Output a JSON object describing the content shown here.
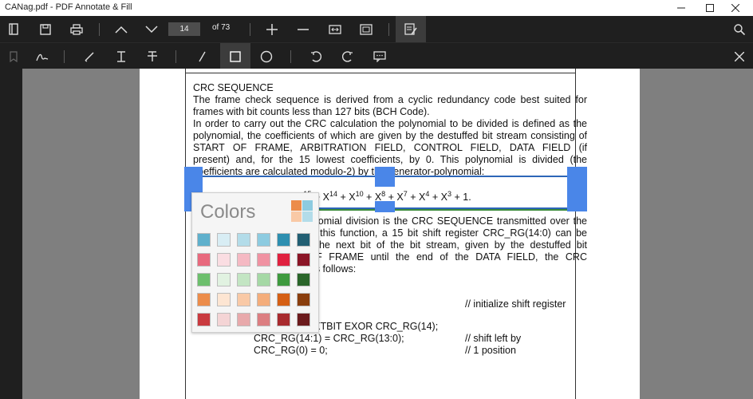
{
  "window": {
    "title": "CANag.pdf - PDF Annotate & Fill"
  },
  "toolbar": {
    "page_number": "14",
    "page_of": "of 73"
  },
  "document": {
    "heading": "CRC SEQUENCE",
    "lines": [
      "The frame check sequence is derived from a cyclic redundancy code best suited for",
      "frames with bit counts less than 127 bits (BCH Code).",
      "In order to carry out the CRC calculation the polynomial to be divided is defined as the",
      "polynomial, the coefficients of which are given by the destuffed bit stream consisting of",
      "START OF FRAME, ARBITRATION FIELD, CONTROL FIELD, DATA FIELD (if",
      "present) and, for the 15 lowest coefficients, by 0. This polynomial is divided (the",
      "coefficients are calculated modulo-2) by the generator-polynomial:"
    ],
    "formula": "X15 + X14 + X10 + X8 + X7 + X4 + X3 + 1.",
    "after_lines": [
      "The remainder of this polynomial division is the CRC SEQUENCE transmitted over the",
      "bus. In order to implement this function, a 15 bit shift register CRC_RG(14:0) can be",
      "used. If NXTBIT denotes the next bit of the bit stream, given by the destuffed bit",
      "sequence from START OF FRAME until the end of the DATA FIELD, the CRC",
      "SEQUENCE is calculated as follows:"
    ],
    "code": {
      "comment1": "// initialize shift register",
      "line_exor": "CRCNXT = NXTBIT EXOR CRC_RG(14);",
      "line_shift": "CRC_RG(14:1) = CRC_RG(13:0);",
      "comment_shift": "// shift left by",
      "line_zero": "CRC_RG(0) = 0;",
      "comment_pos": "// 1 position"
    }
  },
  "colors_panel": {
    "title": "Colors",
    "rows": [
      [
        "#5fb0cc",
        "#d8edf4",
        "#b3dce9",
        "#8dcbe0",
        "#2e8fb0",
        "#225f73"
      ],
      [
        "#e8697d",
        "#fadde2",
        "#f5b9c3",
        "#f092a2",
        "#e0213f",
        "#8a1526"
      ],
      [
        "#6dbf6d",
        "#e1f2e1",
        "#c3e5c3",
        "#a5d8a5",
        "#3e9a3e",
        "#2a652a"
      ],
      [
        "#ec8c4a",
        "#fde5d2",
        "#f9c9a6",
        "#f4ad7b",
        "#d55f14",
        "#8a3e0d"
      ],
      [
        "#c93a3f",
        "#f4d4d5",
        "#e8a9ab",
        "#dc7e81",
        "#a82a2e",
        "#6c1b1d"
      ]
    ]
  }
}
